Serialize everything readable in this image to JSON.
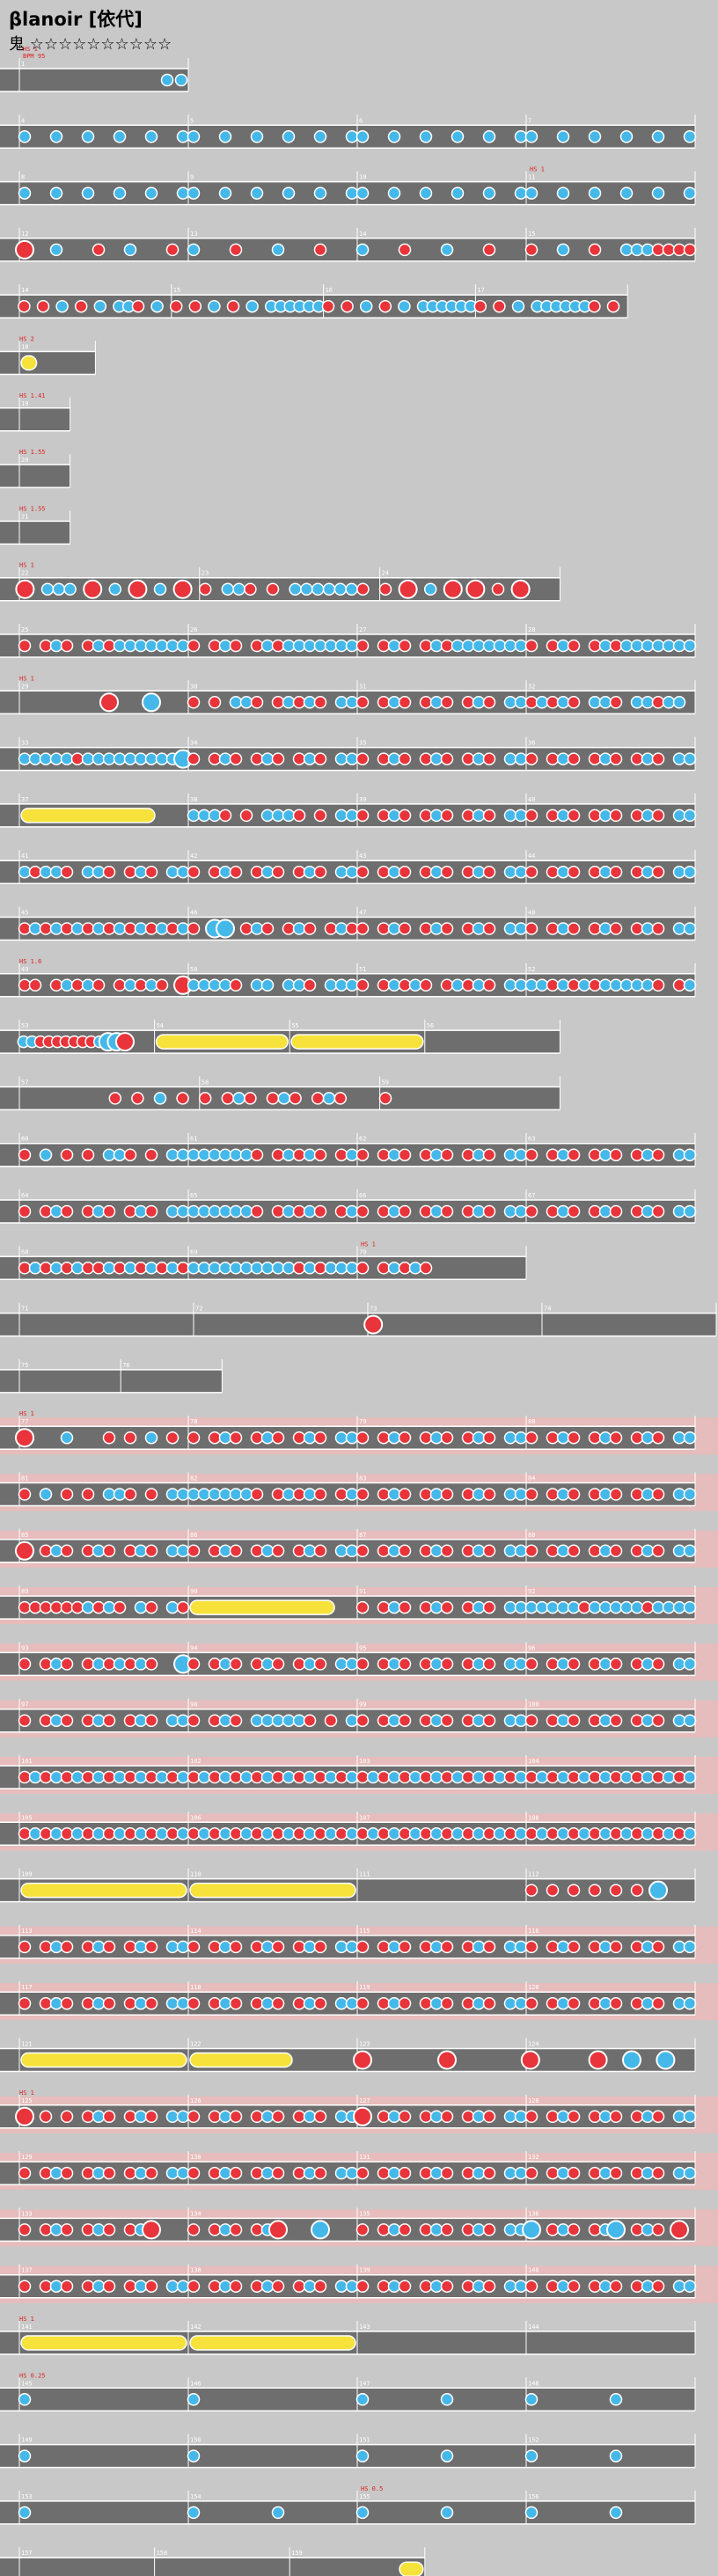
{
  "song": {
    "title": "βlanoir [依代]",
    "difficulty_label": "鬼",
    "star_rating": 10,
    "star_max": 10,
    "stars_text": "☆☆☆☆☆☆☆☆☆☆"
  },
  "colors": {
    "background": "#c8c8c8",
    "lane": "#6e6e6e",
    "lane_border": "#ffffff",
    "gogo_band": "#f4b6b6",
    "don": "#e8343a",
    "ka": "#45b8ea",
    "drumroll": "#f6e23a",
    "marker_text": "#e02020",
    "scroll_text": "#1a40d0"
  },
  "note_legend": {
    "d": "don",
    "k": "ka",
    "D": "big-don",
    "K": "big-ka",
    "r": "drumroll"
  },
  "rows": [
    {
      "measures": [
        {
          "n": "",
          "p": "..........kk",
          "marks": [
            "BPM 95",
            "HS 1"
          ]
        }
      ],
      "len": 1
    },
    {
      "measures": [
        {
          "n": "4",
          "p": "k..k..k..k..k..k"
        },
        {
          "n": "5",
          "p": "k..k..k..k..k..k"
        },
        {
          "n": "6",
          "p": "k..k..k..k..k..k"
        },
        {
          "n": "7",
          "p": "k..k..k..k..k..k"
        }
      ]
    },
    {
      "measures": [
        {
          "n": "8",
          "p": "k..k..k..k..k..k"
        },
        {
          "n": "9",
          "p": "k..k..k..k..k..k"
        },
        {
          "n": "10",
          "p": "k..k..k..k..k..k"
        },
        {
          "n": "11",
          "p": "k..k..k..k..k..k",
          "marks": [
            "HS 1"
          ]
        }
      ]
    },
    {
      "measures": [
        {
          "n": "12",
          "p": "D..k...d..k...d."
        },
        {
          "n": "13",
          "p": "k...d...k...d..."
        },
        {
          "n": "14",
          "p": "k...d...k...d..."
        },
        {
          "n": "15",
          "p": "d..k..d..kkkdddd"
        }
      ]
    },
    {
      "measures": [
        {
          "n": "",
          "p": "d.d.k.d.k.kkd.k."
        },
        {
          "n": "",
          "p": "d.d.k.d.k.kkkkkk"
        },
        {
          "n": "",
          "p": "d.d.k.d.k.kkkkkk"
        },
        {
          "n": "",
          "p": "d.d.k.kkkkkkd.d."
        }
      ],
      "len": 3.6
    },
    {
      "measures": [
        {
          "n": "",
          "p": "rrrr............"
        }
      ],
      "len": 0.45,
      "marks": [
        "HS 2"
      ]
    },
    {
      "measures": [
        {
          "n": "",
          "p": ""
        }
      ],
      "len": 0.3,
      "marks": [
        "HS 1.41"
      ]
    },
    {
      "measures": [
        {
          "n": "",
          "p": ""
        }
      ],
      "len": 0.3,
      "marks": [
        "HS 1.55"
      ]
    },
    {
      "measures": [
        {
          "n": "",
          "p": ""
        }
      ],
      "len": 0.3,
      "marks": [
        "HS 1.55"
      ]
    },
    {
      "measures": [
        {
          "n": "",
          "p": "D.kkk.D.k.D.k.D."
        },
        {
          "n": "",
          "p": "d.kkd.d.kkkkkkd."
        },
        {
          "n": "",
          "p": "d.D.k.D.D.d.D..."
        }
      ],
      "len": 3.2,
      "marks": [
        "HS 1"
      ]
    },
    {
      "measures": [
        {
          "n": "",
          "p": "d.dkd.dkdkkkkkkk"
        },
        {
          "n": "",
          "p": "d.dkd.dkdkkkkkkk"
        },
        {
          "n": "",
          "p": "d.dkd.dkdkkkkkkk"
        },
        {
          "n": "",
          "p": "d.dkd.dkdkkkkkkk"
        }
      ]
    },
    {
      "measures": [
        {
          "n": "",
          "p": "........D...K..."
        },
        {
          "n": "",
          "p": "d.d.kkd.dkdkd.kk"
        },
        {
          "n": "",
          "p": "d.dkd.dkd.dkd.kk"
        },
        {
          "n": "",
          "p": "dkdkd.kkd.kkdkk."
        }
      ],
      "marks": [
        "HS 1"
      ]
    },
    {
      "measures": [
        {
          "n": "",
          "p": "kkkkkdkkkkkkkkkK"
        },
        {
          "n": "",
          "p": "d.dkd.dkd.dkd.kk"
        },
        {
          "n": "",
          "p": "d.dkd.dkd.dkd.kk"
        },
        {
          "n": "",
          "p": "d.dkd.dkd.dkd.kk"
        }
      ]
    },
    {
      "measures": [
        {
          "n": "",
          "p": "rrrrrrrrrrrrr..."
        },
        {
          "n": "",
          "p": "kkkd.d.kkkd.d.kk"
        },
        {
          "n": "",
          "p": "d.dkd.dkd.dkd.kk"
        },
        {
          "n": "",
          "p": "d.dkd.dkd.dkd.kk"
        }
      ]
    },
    {
      "measures": [
        {
          "n": "",
          "p": "kdkkd.kkd.dkd.kk"
        },
        {
          "n": "",
          "p": "d.dkd.dkd.dkd.kk"
        },
        {
          "n": "",
          "p": "d.dkd.dkd.dkd.kk"
        },
        {
          "n": "",
          "p": "d.dkd.dkd.dkd.kk"
        }
      ]
    },
    {
      "measures": [
        {
          "n": "",
          "p": "dkdkdkdkdkdkdkdk"
        },
        {
          "n": "",
          "p": "d.KK.dkd.dkd.dkd"
        },
        {
          "n": "",
          "p": "d.dkd.dkd.dkd.kk"
        },
        {
          "n": "",
          "p": "d.dkd.dkd.dkd.kk"
        }
      ]
    },
    {
      "measures": [
        {
          "n": "",
          "p": "dd.dkdkd.dkdkd.D"
        },
        {
          "n": "",
          "p": "kkkkd.kk.kkd.kkk"
        },
        {
          "n": "",
          "p": "d.dkdkd.dkdkd.kk"
        },
        {
          "n": "",
          "p": "kkdkdkdkkkkkd.dk"
        }
      ],
      "marks": [
        "HS 1.6"
      ]
    },
    {
      "measures": [
        {
          "n": "",
          "p": "kkdddddddkKKD..."
        },
        {
          "n": "",
          "p": "rrrrrrrrrrrrrrrr"
        },
        {
          "n": "",
          "p": "rrrrrrrrrrrrrrrr"
        },
        {
          "n": "",
          "p": ""
        }
      ],
      "len": 3.2
    },
    {
      "measures": [
        {
          "n": "",
          "p": "........d.d.k.d."
        },
        {
          "n": "",
          "p": "d.dkd.dkd.dkd..."
        },
        {
          "n": "",
          "p": "d..............."
        }
      ],
      "len": 3.2
    },
    {
      "measures": [
        {
          "n": "",
          "p": "d.k.d.d.kkd.d.kk"
        },
        {
          "n": "",
          "p": "kkkkkkd.dkdkd.dk"
        },
        {
          "n": "",
          "p": "d.dkd.dkd.dkd.kk"
        },
        {
          "n": "",
          "p": "d.dkd.dkd.dkd.kk"
        }
      ]
    },
    {
      "measures": [
        {
          "n": "",
          "p": "d.dkd.dkd.dkd.kk"
        },
        {
          "n": "",
          "p": "kkkkkkd.dkdkd.dk"
        },
        {
          "n": "",
          "p": "d.dkd.dkd.dkd.kk"
        },
        {
          "n": "",
          "p": "d.dkd.dkd.dkd.kk"
        }
      ]
    },
    {
      "measures": [
        {
          "n": "",
          "p": "dkdkdkddkdkdkdkd"
        },
        {
          "n": "",
          "p": "kkkkkkkkkkdkdkkk"
        },
        {
          "n": "",
          "p": "d.dkdkd.........",
          "marks": [
            "HS 1"
          ]
        }
      ],
      "len": 3
    },
    {
      "measures": [
        {
          "n": "",
          "p": ""
        },
        {
          "n": "",
          "p": ""
        },
        {
          "n": "",
          "p": "D..............."
        },
        {
          "n": "",
          "p": ""
        }
      ],
      "len": 4.2
    },
    {
      "measures": [
        {
          "n": "",
          "p": ""
        },
        {
          "n": "",
          "p": ""
        }
      ],
      "len": 1.2
    },
    {
      "measures": [
        {
          "n": "",
          "p": "D...k...d.d.k.d."
        },
        {
          "n": "",
          "p": "d.dkd.dkd.dkd.kk"
        },
        {
          "n": "",
          "p": "d.dkd.dkd.dkd.kk"
        },
        {
          "n": "",
          "p": "d.dkd.dkd.dkd.kk"
        }
      ],
      "gogo": true,
      "marks": [
        "HS 1"
      ]
    },
    {
      "measures": [
        {
          "n": "",
          "p": "d.k.d.d.kkd.d.kk"
        },
        {
          "n": "",
          "p": "kkkkkkd.dkdkd.dk"
        },
        {
          "n": "",
          "p": "d.dkd.dkd.dkd.kk"
        },
        {
          "n": "",
          "p": "d.dkd.dkd.dkd.kk"
        }
      ],
      "gogo": true
    },
    {
      "measures": [
        {
          "n": "",
          "p": "D.dkd.dkd.dkd.kk"
        },
        {
          "n": "",
          "p": "d.dkd.dkd.dkd.kk"
        },
        {
          "n": "",
          "p": "d.dkd.dkd.dkd.kk"
        },
        {
          "n": "",
          "p": "d.dkd.dkd.dkd.kk"
        }
      ],
      "gogo": true
    },
    {
      "measures": [
        {
          "n": "",
          "p": "ddddddkdkd.kd.kd"
        },
        {
          "n": "",
          "p": "rrrrrrrrrrrrrr.."
        },
        {
          "n": "",
          "p": "d.dkd.dkd.dkd.kk"
        },
        {
          "n": "",
          "p": "kkkkkdkkkkkdkkkk"
        }
      ],
      "gogo": true
    },
    {
      "measures": [
        {
          "n": "",
          "p": "d.dkd.dkdkdkd..K"
        },
        {
          "n": "",
          "p": "d.dkd.dkd.dkd.kk"
        },
        {
          "n": "",
          "p": "d.dkd.dkd.dkd.kk"
        },
        {
          "n": "",
          "p": "d.dkd.dkd.dkd.kk"
        }
      ],
      "gogo": true
    },
    {
      "measures": [
        {
          "n": "",
          "p": "d.dkd.dkd.dkd.kk"
        },
        {
          "n": "",
          "p": "d.dkd.kkkkkd.d.k"
        },
        {
          "n": "",
          "p": "d.dkd.dkd.dkd.kk"
        },
        {
          "n": "",
          "p": "d.dkd.dkd.dkd.kk"
        }
      ],
      "gogo": true
    },
    {
      "measures": [
        {
          "n": "",
          "p": "dkdkdkdkdkdkdkdk"
        },
        {
          "n": "",
          "p": "dkdkdkdkdkdkdkdk"
        },
        {
          "n": "",
          "p": "dkdkdkdkdkdkdkdk"
        },
        {
          "n": "",
          "p": "dkdkdkdkdkdkdkdk"
        }
      ],
      "gogo": true
    },
    {
      "measures": [
        {
          "n": "",
          "p": "dkdkdkdkdkdkdkdk"
        },
        {
          "n": "",
          "p": "dkdkdkdkdkdkdkdk"
        },
        {
          "n": "",
          "p": "dkdkdkdkdkdkdkdk"
        },
        {
          "n": "",
          "p": "dkdkdkdkdkdkdkdk"
        }
      ],
      "gogo": true
    },
    {
      "measures": [
        {
          "n": "",
          "p": "rrrrrrrrrrrrrrrr"
        },
        {
          "n": "",
          "p": "rrrrrrrrrrrrrrrr"
        },
        {
          "n": "",
          "p": ""
        },
        {
          "n": "",
          "p": "d.d.d.d.d.d.K..."
        }
      ]
    },
    {
      "measures": [
        {
          "n": "",
          "p": "d.dkd.dkd.dkd.kk"
        },
        {
          "n": "",
          "p": "d.dkd.dkd.dkd.kk"
        },
        {
          "n": "",
          "p": "d.dkd.dkd.dkd.kk"
        },
        {
          "n": "",
          "p": "d.dkd.dkd.dkd.kk"
        }
      ],
      "gogo": true
    },
    {
      "measures": [
        {
          "n": "",
          "p": "d.dkd.dkd.dkd.kk"
        },
        {
          "n": "",
          "p": "d.dkd.dkd.dkd.kk"
        },
        {
          "n": "",
          "p": "d.dkd.dkd.dkd.kk"
        },
        {
          "n": "",
          "p": "d.dkd.dkd.dkd.kk"
        }
      ],
      "gogo": true
    },
    {
      "measures": [
        {
          "n": "",
          "p": "rrrrrrrrrrrrrrrr"
        },
        {
          "n": "",
          "p": "rrrrrrrrrr......"
        },
        {
          "n": "",
          "p": "D.......D......."
        },
        {
          "n": "",
          "p": "D.......D...K...K..."
        }
      ]
    },
    {
      "measures": [
        {
          "n": "",
          "p": "D.d.d.dkd.dkd.kk"
        },
        {
          "n": "",
          "p": "d.dkd.dkd.dkd.kk"
        },
        {
          "n": "",
          "p": "D.dkd.dkd.dkd.kk"
        },
        {
          "n": "",
          "p": "d.dkd.dkd.dkd.kk"
        }
      ],
      "gogo": true,
      "marks": [
        "HS 1"
      ]
    },
    {
      "measures": [
        {
          "n": "",
          "p": "d.dkd.dkd.dkd.kk"
        },
        {
          "n": "",
          "p": "d.dkd.dkd.dkd.kk"
        },
        {
          "n": "",
          "p": "d.dkd.dkd.dkd.kk"
        },
        {
          "n": "",
          "p": "d.dkd.dkd.dkd.kk"
        }
      ],
      "gogo": true
    },
    {
      "measures": [
        {
          "n": "",
          "p": "d.dkd.dkd.dkD..."
        },
        {
          "n": "",
          "p": "d.dkd.dkD...K..."
        },
        {
          "n": "",
          "p": "d.dkd.dkd.dkd.kk"
        },
        {
          "n": "",
          "p": "K.dkd.dkK.dkd.D."
        }
      ],
      "gogo": true
    },
    {
      "measures": [
        {
          "n": "",
          "p": "d.dkd.dkd.dkd.kk"
        },
        {
          "n": "",
          "p": "d.dkd.dkd.dkd.kk"
        },
        {
          "n": "",
          "p": "d.dkd.dkd.dkd.kk"
        },
        {
          "n": "",
          "p": "d.dkd.dkd.dkd.kk"
        }
      ],
      "gogo": true
    },
    {
      "measures": [
        {
          "n": "",
          "p": "rrrrrrrrrrrrrrrr"
        },
        {
          "n": "",
          "p": "rrrrrrrrrrrrrrrr"
        },
        {
          "n": "",
          "p": ""
        },
        {
          "n": "",
          "p": ""
        }
      ],
      "marks": [
        "HS 1"
      ]
    },
    {
      "measures": [
        {
          "n": "",
          "p": "k..............."
        },
        {
          "n": "",
          "p": "k..............."
        },
        {
          "n": "",
          "p": "k.......k......."
        },
        {
          "n": "",
          "p": "k.......k......."
        }
      ],
      "marks": [
        "HS 0.25"
      ]
    },
    {
      "measures": [
        {
          "n": "",
          "p": "k..............."
        },
        {
          "n": "",
          "p": "k..............."
        },
        {
          "n": "",
          "p": "k.......k......."
        },
        {
          "n": "",
          "p": "k.......k......."
        }
      ]
    },
    {
      "measures": [
        {
          "n": "",
          "p": "k..............."
        },
        {
          "n": "",
          "p": "k.......k......."
        },
        {
          "n": "",
          "p": "k.......k.......",
          "marks": [
            "HS 0.5"
          ]
        },
        {
          "n": "",
          "p": "k.......k......."
        }
      ]
    },
    {
      "measures": [
        {
          "n": "",
          "p": ""
        },
        {
          "n": "",
          "p": ""
        },
        {
          "n": "",
          "p": "................rrrr"
        }
      ],
      "len": 2.4
    }
  ]
}
